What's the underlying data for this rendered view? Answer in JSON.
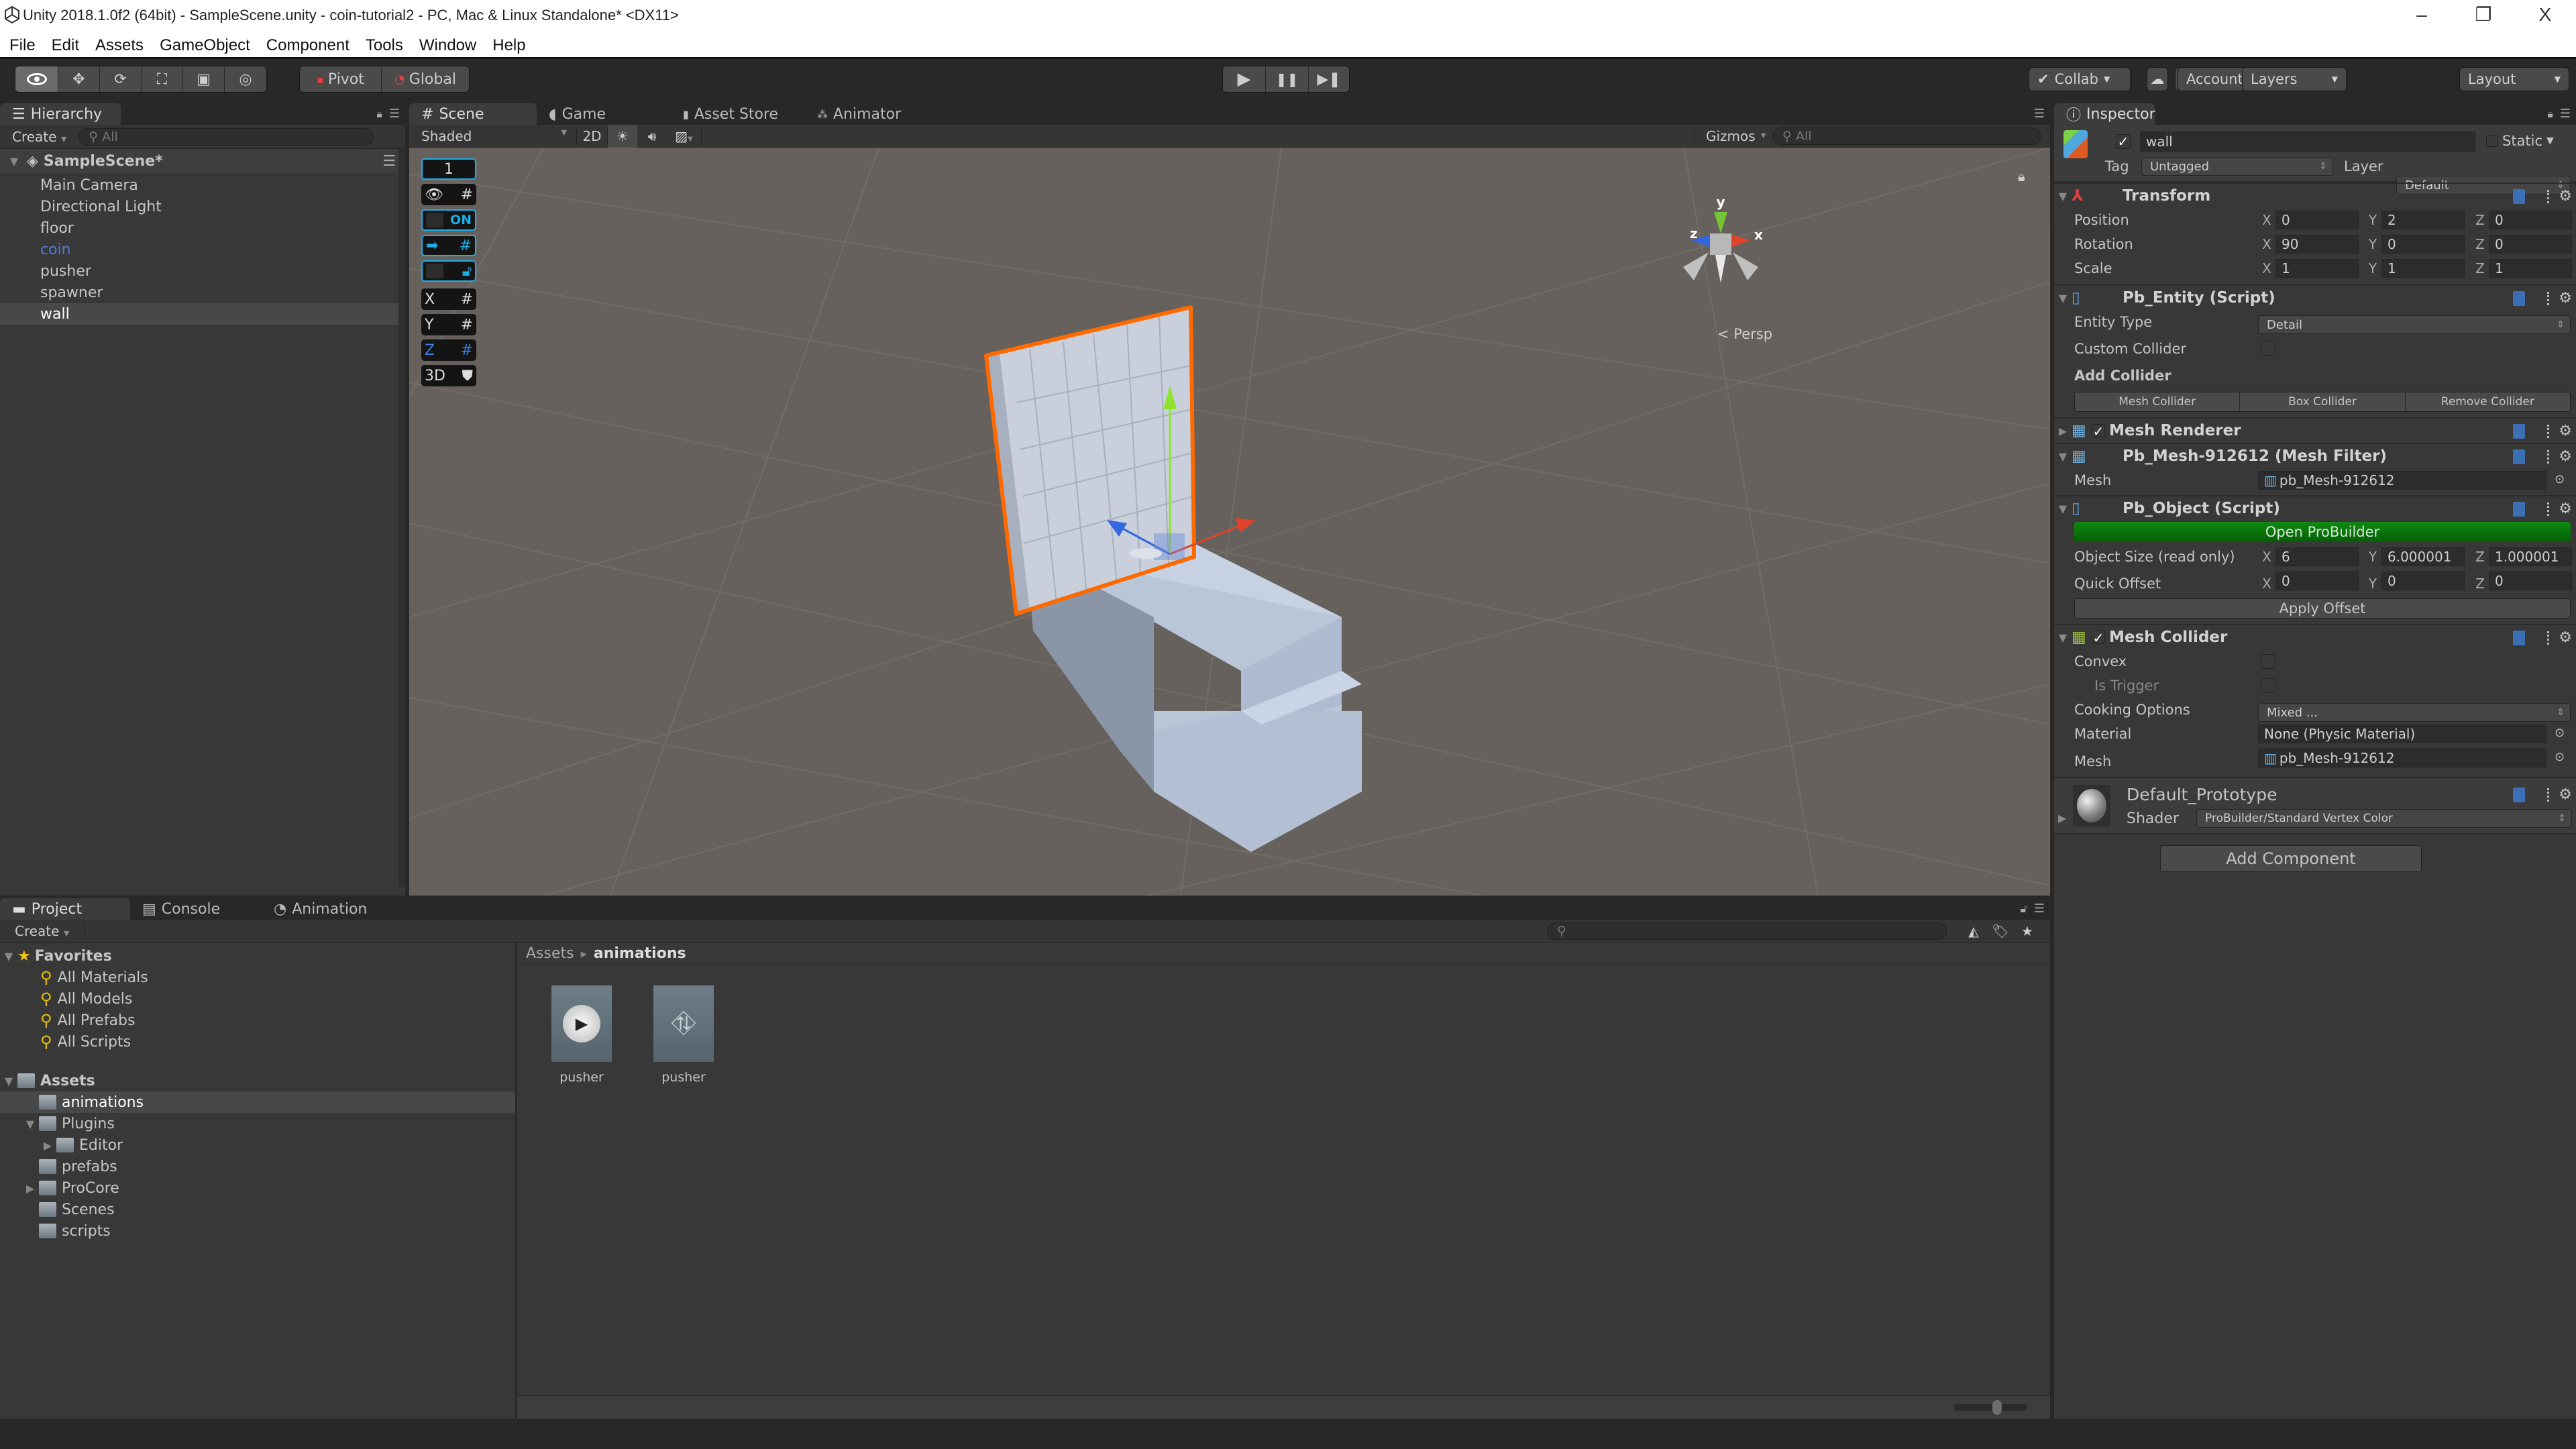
{
  "window": {
    "title": "Unity 2018.1.0f2 (64bit) - SampleScene.unity - coin-tutorial2 - PC, Mac & Linux Standalone* <DX11>",
    "controls": [
      "–",
      "❐",
      "X"
    ]
  },
  "menu": [
    "File",
    "Edit",
    "Assets",
    "GameObject",
    "Component",
    "Tools",
    "Window",
    "Help"
  ],
  "toolbar": {
    "transform_tools": [
      "view-tool",
      "move-tool",
      "rotate-tool",
      "scale-tool",
      "rect-tool",
      "transform-tool"
    ],
    "pivot_label": "Pivot",
    "global_label": "Global",
    "play": "▶",
    "pause": "❚❚",
    "step": "▶❚",
    "collab_label": "Collab",
    "account_label": "Account",
    "layers_label": "Layers",
    "layout_label": "Layout"
  },
  "hierarchy": {
    "tab_label": "Hierarchy",
    "create_label": "Create",
    "search_placeholder": "All",
    "scene_name": "SampleScene*",
    "items": [
      {
        "label": "Main Camera",
        "state": "normal"
      },
      {
        "label": "Directional Light",
        "state": "normal"
      },
      {
        "label": "floor",
        "state": "normal"
      },
      {
        "label": "coin",
        "state": "prefab"
      },
      {
        "label": "pusher",
        "state": "normal"
      },
      {
        "label": "spawner",
        "state": "normal"
      },
      {
        "label": "wall",
        "state": "selected"
      }
    ]
  },
  "scene": {
    "tabs": [
      "Scene",
      "Game",
      "Asset Store",
      "Animator"
    ],
    "active_tab": "Scene",
    "draw_mode": "Shaded",
    "mode_2d": "2D",
    "gizmos_label": "Gizmos",
    "search_placeholder": "All",
    "projection_label": "Persp",
    "axis_labels": {
      "x": "x",
      "y": "y",
      "z": "z"
    },
    "probuilder_overlay": [
      "1",
      "eye-grid",
      "ON",
      "arrow-grid",
      "lock",
      "X",
      "Y",
      "Z",
      "3D"
    ],
    "colors": {
      "selection_outline": "#ff6a00",
      "axis_x": "#e0432a",
      "axis_y": "#8fe32c",
      "axis_z": "#3466e0",
      "viewport": "#66615c"
    }
  },
  "inspector": {
    "tab_label": "Inspector",
    "object_name": "wall",
    "active": true,
    "static_label": "Static",
    "tag_label": "Tag",
    "tag_value": "Untagged",
    "layer_label": "Layer",
    "layer_value": "Default",
    "transform": {
      "title": "Transform",
      "rows": [
        {
          "label": "Position",
          "x": "0",
          "y": "2",
          "z": "0"
        },
        {
          "label": "Rotation",
          "x": "90",
          "y": "0",
          "z": "0"
        },
        {
          "label": "Scale",
          "x": "1",
          "y": "1",
          "z": "1"
        }
      ]
    },
    "pb_entity": {
      "title": "Pb_Entity (Script)",
      "entity_type_label": "Entity Type",
      "entity_type_value": "Detail",
      "custom_collider_label": "Custom Collider",
      "custom_collider": false,
      "add_collider_label": "Add Collider",
      "buttons": [
        "Mesh Collider",
        "Box Collider",
        "Remove Collider"
      ]
    },
    "mesh_renderer": {
      "title": "Mesh Renderer",
      "enabled": true
    },
    "mesh_filter": {
      "title": "Pb_Mesh-912612 (Mesh Filter)",
      "mesh_label": "Mesh",
      "mesh_value": "pb_Mesh-912612"
    },
    "pb_object": {
      "title": "Pb_Object (Script)",
      "open_button": "Open ProBuilder",
      "size_label": "Object Size (read only)",
      "size": {
        "x": "6",
        "y": "6.000001",
        "z": "1.000001"
      },
      "offset_label": "Quick Offset",
      "offset": {
        "x": "0",
        "y": "0",
        "z": "0"
      },
      "apply_button": "Apply Offset"
    },
    "mesh_collider": {
      "title": "Mesh Collider",
      "enabled": true,
      "convex_label": "Convex",
      "convex": false,
      "trigger_label": "Is Trigger",
      "trigger": false,
      "cooking_label": "Cooking Options",
      "cooking_value": "Mixed ...",
      "material_label": "Material",
      "material_value": "None (Physic Material)",
      "mesh_label": "Mesh",
      "mesh_value": "pb_Mesh-912612"
    },
    "material": {
      "name": "Default_Prototype",
      "shader_label": "Shader",
      "shader_value": "ProBuilder/Standard Vertex Color"
    },
    "add_component": "Add Component"
  },
  "project": {
    "tabs": [
      "Project",
      "Console",
      "Animation"
    ],
    "create_label": "Create",
    "favorites_label": "Favorites",
    "favorites": [
      "All Materials",
      "All Models",
      "All Prefabs",
      "All Scripts"
    ],
    "assets_label": "Assets",
    "folders": [
      {
        "label": "animations",
        "depth": 1,
        "arrow": "",
        "selected": true
      },
      {
        "label": "Plugins",
        "depth": 1,
        "arrow": "▼",
        "selected": false
      },
      {
        "label": "Editor",
        "depth": 2,
        "arrow": "▶",
        "selected": false
      },
      {
        "label": "prefabs",
        "depth": 1,
        "arrow": "",
        "selected": false
      },
      {
        "label": "ProCore",
        "depth": 1,
        "arrow": "▶",
        "selected": false
      },
      {
        "label": "Scenes",
        "depth": 1,
        "arrow": "",
        "selected": false
      },
      {
        "label": "scripts",
        "depth": 1,
        "arrow": "",
        "selected": false
      }
    ],
    "breadcrumb": [
      "Assets",
      "animations"
    ],
    "files": [
      {
        "label": "pusher",
        "type": "animation-clip"
      },
      {
        "label": "pusher",
        "type": "animator-controller"
      }
    ],
    "icon_size_slider": 0.6
  }
}
